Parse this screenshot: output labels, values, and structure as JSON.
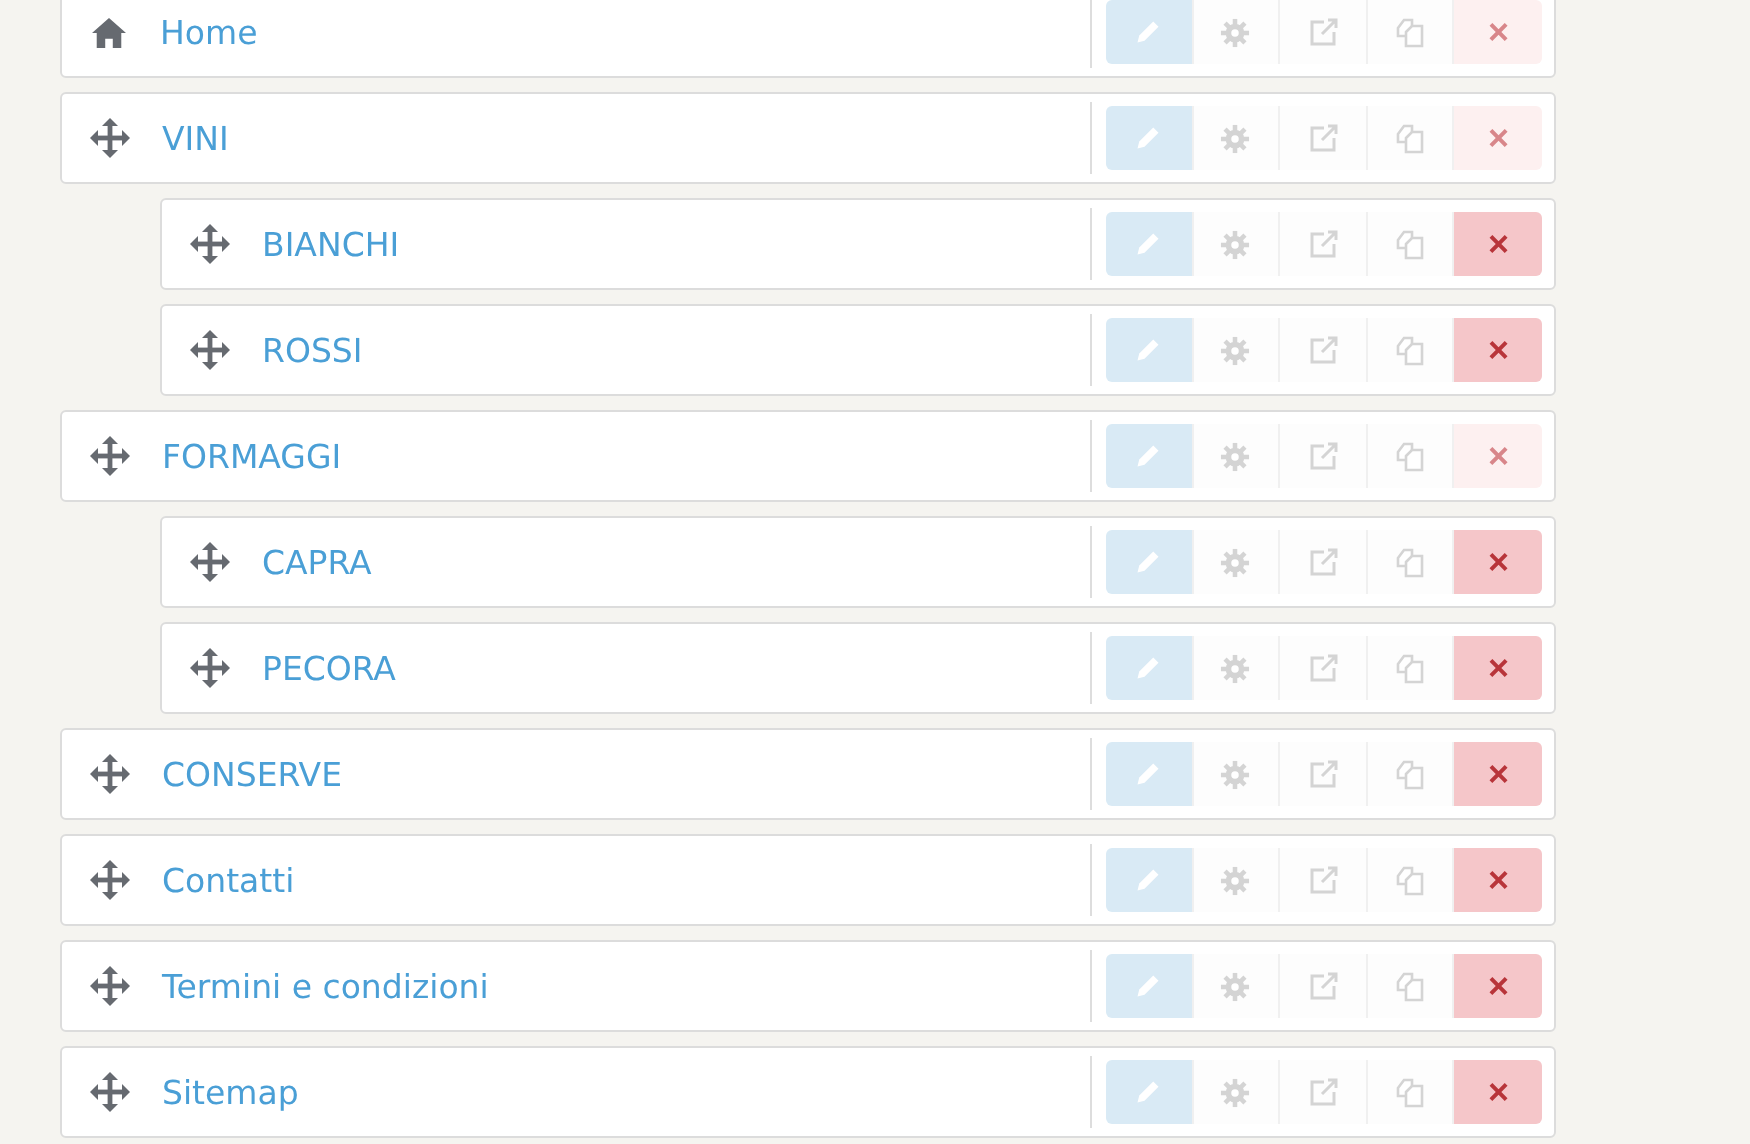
{
  "menu_items": [
    {
      "label": "Home",
      "kind": "home",
      "delete": {
        "text": "×",
        "disabled": true
      }
    },
    {
      "label": "VINI",
      "kind": "move",
      "delete": {
        "text": "×",
        "disabled": true
      },
      "children": [
        {
          "label": "BIANCHI",
          "kind": "move",
          "delete": {
            "text": "×",
            "disabled": false
          }
        },
        {
          "label": "ROSSI",
          "kind": "move",
          "delete": {
            "text": "×",
            "disabled": false
          }
        }
      ]
    },
    {
      "label": "FORMAGGI",
      "kind": "move",
      "delete": {
        "text": "×",
        "disabled": true
      },
      "children": [
        {
          "label": "CAPRA",
          "kind": "move",
          "delete": {
            "text": "×",
            "disabled": false
          }
        },
        {
          "label": "PECORA",
          "kind": "move",
          "delete": {
            "text": "×",
            "disabled": false
          }
        }
      ]
    },
    {
      "label": "CONSERVE",
      "kind": "move",
      "delete": {
        "text": "×",
        "disabled": false
      }
    },
    {
      "label": "Contatti",
      "kind": "move",
      "delete": {
        "text": "×",
        "disabled": false
      }
    },
    {
      "label": "Termini e condizioni",
      "kind": "move",
      "delete": {
        "text": "×",
        "disabled": false
      }
    },
    {
      "label": "Sitemap",
      "kind": "move",
      "delete": {
        "text": "×",
        "disabled": false
      }
    }
  ]
}
